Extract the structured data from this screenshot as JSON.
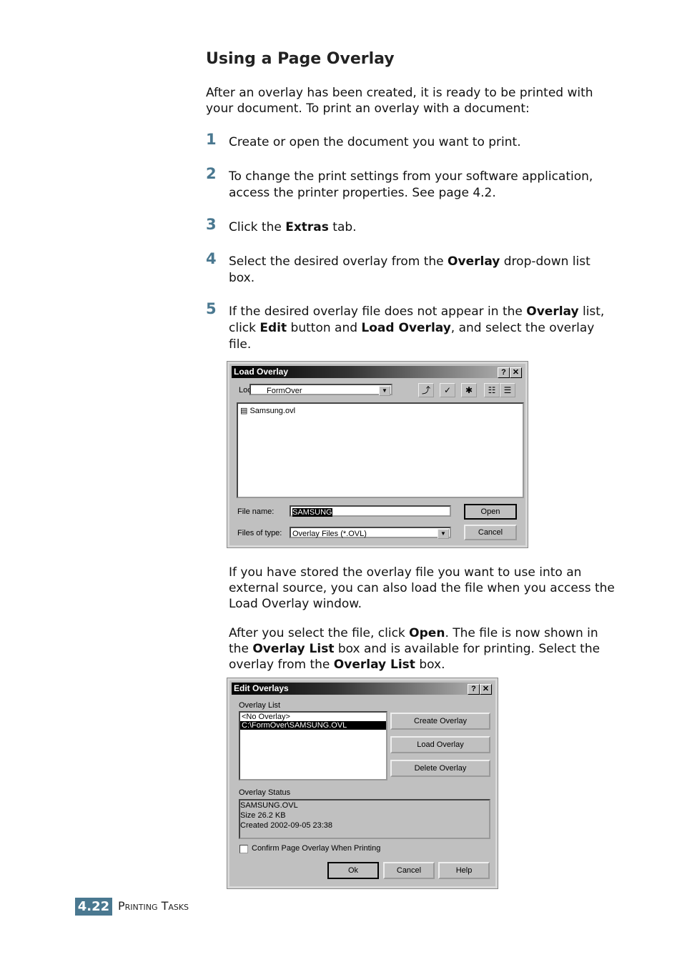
{
  "title": "Using a Page Overlay",
  "intro": "After an overlay has been created, it is ready to be printed with your document. To print an overlay with a document:",
  "steps": [
    {
      "num": "1",
      "html": "Create or open the document you want to print."
    },
    {
      "num": "2",
      "html": "To change the print settings from your software application, access the printer properties. See page 4.2."
    },
    {
      "num": "3",
      "html": "Click the <b>Extras</b> tab."
    },
    {
      "num": "4",
      "html": "Select the desired overlay from the <b>Overlay</b> drop-down list box."
    },
    {
      "num": "5",
      "html": "If the desired overlay file does not appear in the <b>Overlay</b> list, click <b>Edit</b> button and <b>Load Overlay</b>, and select the overlay file."
    }
  ],
  "para2": "If you have stored the overlay file you want to use into an external source, you can also load the file when you access the Load Overlay window.",
  "para3_html": "After you select the file, click <b>Open</b>. The file is now shown in the <b>Overlay List</b> box and is available for printing. Select the overlay from the <b>Overlay List</b> box.",
  "load_dialog": {
    "title": "Load Overlay",
    "look_in_label": "Look in:",
    "look_in_value": "FormOver",
    "file": "Samsung.ovl",
    "file_name_label": "File name:",
    "file_name_value": "SAMSUNG",
    "files_type_label": "Files of type:",
    "files_type_value": "Overlay Files (*.OVL)",
    "open": "Open",
    "cancel": "Cancel",
    "help": "?",
    "close": "✕"
  },
  "edit_dialog": {
    "title": "Edit Overlays",
    "list_label": "Overlay List",
    "items": [
      "<No Overlay>",
      "C:\\FormOver\\SAMSUNG.OVL"
    ],
    "create": "Create Overlay",
    "load": "Load Overlay",
    "delete": "Delete Overlay",
    "status_label": "Overlay Status",
    "status_lines": [
      "SAMSUNG.OVL",
      "Size 26.2 KB",
      "Created 2002-09-05 23:38"
    ],
    "confirm": "Confirm Page Overlay When Printing",
    "ok": "Ok",
    "cancel": "Cancel",
    "helpbtn": "Help",
    "help": "?",
    "close": "✕"
  },
  "footer": {
    "num": "4.22",
    "section": "Printing Tasks"
  }
}
